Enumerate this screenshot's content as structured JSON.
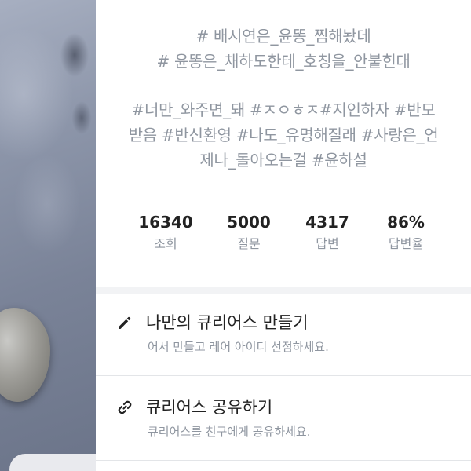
{
  "hashtags": {
    "line1": "# 배시연은_윤똥_찜해놨데",
    "line2": "# 윤똥은_채하도한테_호칭을_안붙힌대",
    "line3": "#너만_와주면_돼 #ㅈㅇㅎㅈ#지인하자 #반모",
    "line4": "받음 #반신환영 #나도_유명해질래 #사랑은_언",
    "line5": "제나_돌아오는걸 #윤하설"
  },
  "stats": [
    {
      "value": "16340",
      "label": "조회"
    },
    {
      "value": "5000",
      "label": "질문"
    },
    {
      "value": "4317",
      "label": "답변"
    },
    {
      "value": "86%",
      "label": "답변율"
    }
  ],
  "menu": [
    {
      "icon": "pencil-icon",
      "title": "나만의 큐리어스 만들기",
      "description": "어서 만들고 레어 아이디 선점하세요."
    },
    {
      "icon": "link-icon",
      "title": "큐리어스 공유하기",
      "description": "큐리어스를 친구에게 공유하세요."
    }
  ],
  "colors": {
    "panel_bg": "#ffffff",
    "muted_text": "#8f96a0",
    "primary_text": "#222222",
    "divider": "#f2f3f5"
  }
}
